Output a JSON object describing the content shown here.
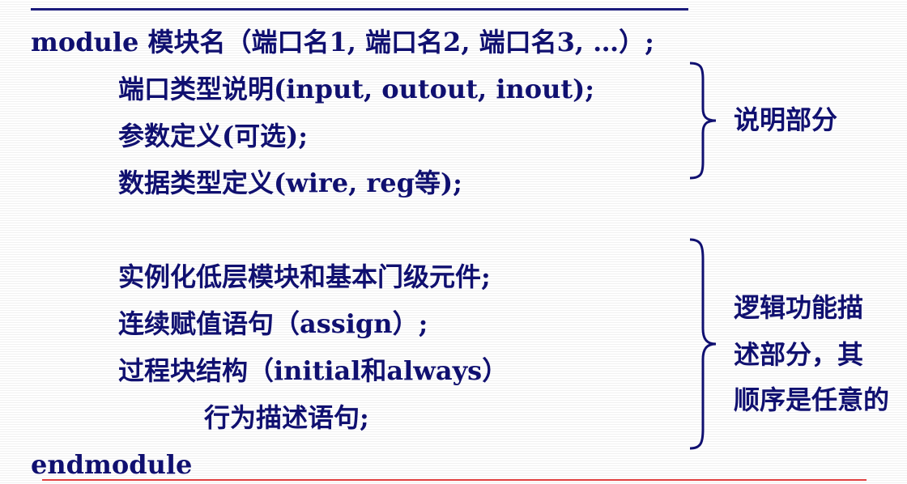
{
  "code": {
    "module_line": "module 模块名（端口名1, 端口名2, 端口名3, …）;",
    "declaration_lines": [
      "端口类型说明(input, outout, inout);",
      "参数定义(可选);",
      "数据类型定义(wire, reg等);"
    ],
    "logic_lines": [
      "实例化低层模块和基本门级元件;",
      "连续赋值语句（assign）;",
      "过程块结构（initial和always）",
      "行为描述语句;"
    ],
    "end_line": "endmodule"
  },
  "annotations": {
    "declaration_label": "说明部分",
    "logic_label_lines": [
      "逻辑功能描",
      "述部分，其",
      "顺序是任意的"
    ]
  },
  "colors": {
    "text": "#101070",
    "top_rule": "#1a1a7a",
    "bottom_rule": "#e04040"
  }
}
